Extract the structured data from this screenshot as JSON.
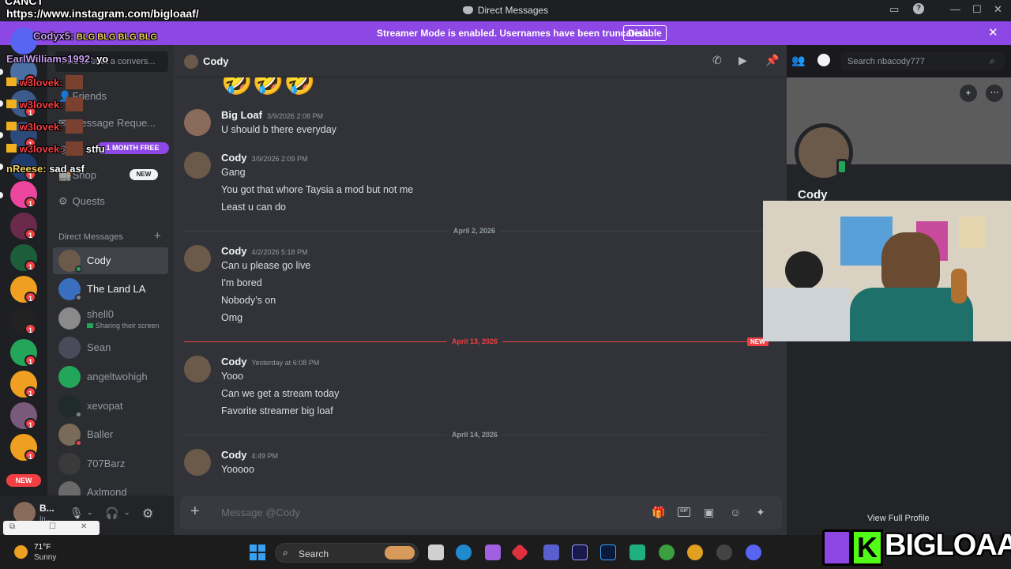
{
  "window": {
    "title": "Direct Messages",
    "url_overlay": "https://www.instagram.com/bigloaaf/",
    "top_overlay": "CANCT"
  },
  "banner": {
    "message": "Streamer Mode is enabled. Usernames have been truncated.",
    "disable_label": "Disable"
  },
  "chat_overlay": [
    {
      "user": "Codyx5:",
      "text": "BLG BLG BLG BLG"
    },
    {
      "user": "EarlWilliams1992:",
      "text": "yo"
    },
    {
      "user": "w3lovek:",
      "text": ""
    },
    {
      "user": "w3lovek:",
      "text": ""
    },
    {
      "user": "w3lovek:",
      "text": ""
    },
    {
      "user": "w3lovek:",
      "text": "stfu"
    },
    {
      "user": "nReese:",
      "text": "sad asf"
    }
  ],
  "sidebar": {
    "search_placeholder": "Find or start a convers...",
    "nav": [
      {
        "label": "Friends"
      },
      {
        "label": "Message Reque..."
      },
      {
        "label": "Nitro",
        "badge": "1 MONTH FREE"
      },
      {
        "label": "Shop",
        "badge": "NEW"
      },
      {
        "label": "Quests"
      }
    ],
    "dm_header": "Direct Messages",
    "dms": [
      {
        "name": "Cody",
        "selected": true
      },
      {
        "name": "The Land LA"
      },
      {
        "name": "shell0",
        "sub": "Sharing their screen"
      },
      {
        "name": "Sean"
      },
      {
        "name": "angeltwohigh"
      },
      {
        "name": "xevopat"
      },
      {
        "name": "Baller"
      },
      {
        "name": "707Barz"
      },
      {
        "name": "Axlmond"
      }
    ],
    "user": {
      "name": "B...",
      "status": "In..."
    },
    "server_new": "NEW"
  },
  "chat_header": {
    "name": "Cody",
    "search_placeholder": "Search nbacody777"
  },
  "messages": [
    {
      "author": "Big Loaf",
      "time": "3/9/2026 2:08 PM",
      "lines": [
        "U should b there everyday"
      ]
    },
    {
      "author": "Cody",
      "time": "3/9/2026 2:09 PM",
      "lines": [
        "Gang",
        "You got that whore Taysia a mod but not me",
        "Least u can do"
      ]
    },
    {
      "divider": "April 2, 2026"
    },
    {
      "author": "Cody",
      "time": "4/2/2026 5:18 PM",
      "lines": [
        "Can u please go live",
        "I'm bored",
        "Nobody’s on",
        "Omg"
      ]
    },
    {
      "divider": "April 13, 2026",
      "new": "NEW"
    },
    {
      "author": "Cody",
      "time": "Yesterday at 6:08 PM",
      "lines": [
        "Yooo",
        "Can we get a stream today",
        "Favorite streamer big loaf"
      ]
    },
    {
      "divider": "April 14, 2026"
    },
    {
      "author": "Cody",
      "time": "4:49 PM",
      "lines": [
        "Yooooo"
      ]
    }
  ],
  "emoji_row": "🤣🤣🤣",
  "composer": {
    "placeholder": "Message @Cody"
  },
  "profile": {
    "name": "Cody",
    "view_full": "View Full Profile"
  },
  "brand": {
    "name": "BIGLOAAF"
  },
  "taskbar": {
    "weather_temp": "71°F",
    "weather_desc": "Sunny",
    "search": "Search"
  },
  "colors": {
    "banner": "#8d47e4",
    "accent": "#5865f2",
    "mention_new": "#f23f43"
  }
}
